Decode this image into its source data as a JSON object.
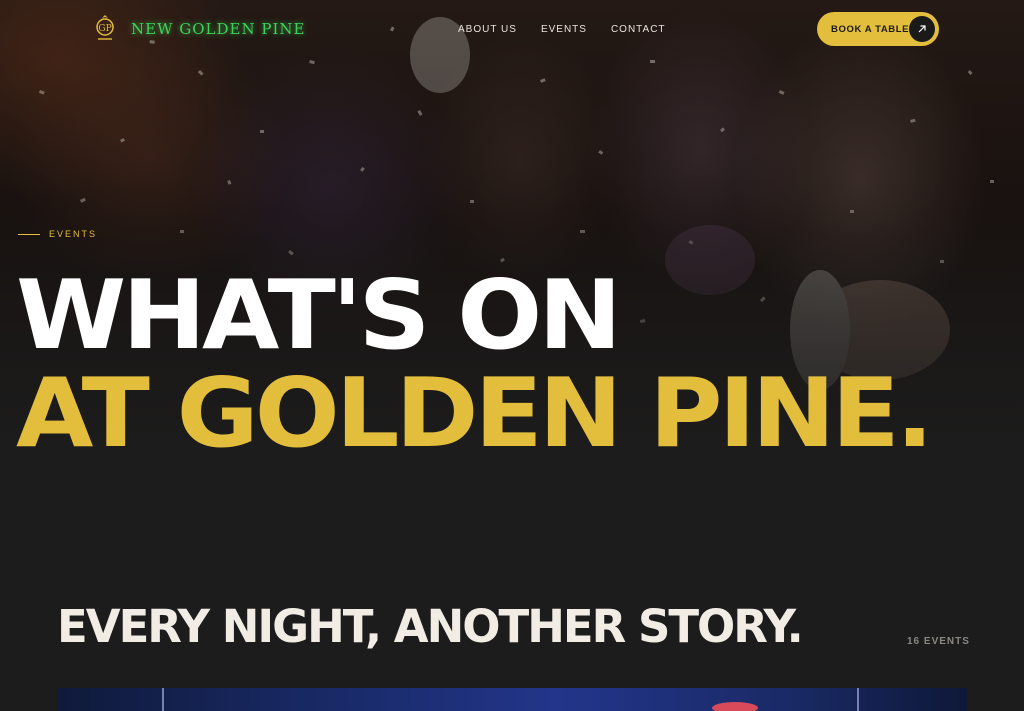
{
  "nav": {
    "brand": "NEW GOLDEN PINE",
    "logo_icon": "golden-pine-crest-icon",
    "links": [
      {
        "label": "ABOUT US"
      },
      {
        "label": "EVENTS"
      },
      {
        "label": "CONTACT"
      }
    ],
    "cta_label": "BOOK A TABLE",
    "cta_icon": "arrow-up-right-icon"
  },
  "hero": {
    "eyebrow": "EVENTS",
    "headline_line1": "WHAT'S ON",
    "headline_line2": "AT GOLDEN PINE."
  },
  "events_section": {
    "title": "EVERY NIGHT, ANOTHER STORY.",
    "count_label": "16 EVENTS"
  },
  "colors": {
    "accent": "#e3bd3c",
    "brand_green": "#3bd35a",
    "background": "#1c1c1c",
    "headline_white": "#ffffff",
    "muted": "#8a8782"
  }
}
